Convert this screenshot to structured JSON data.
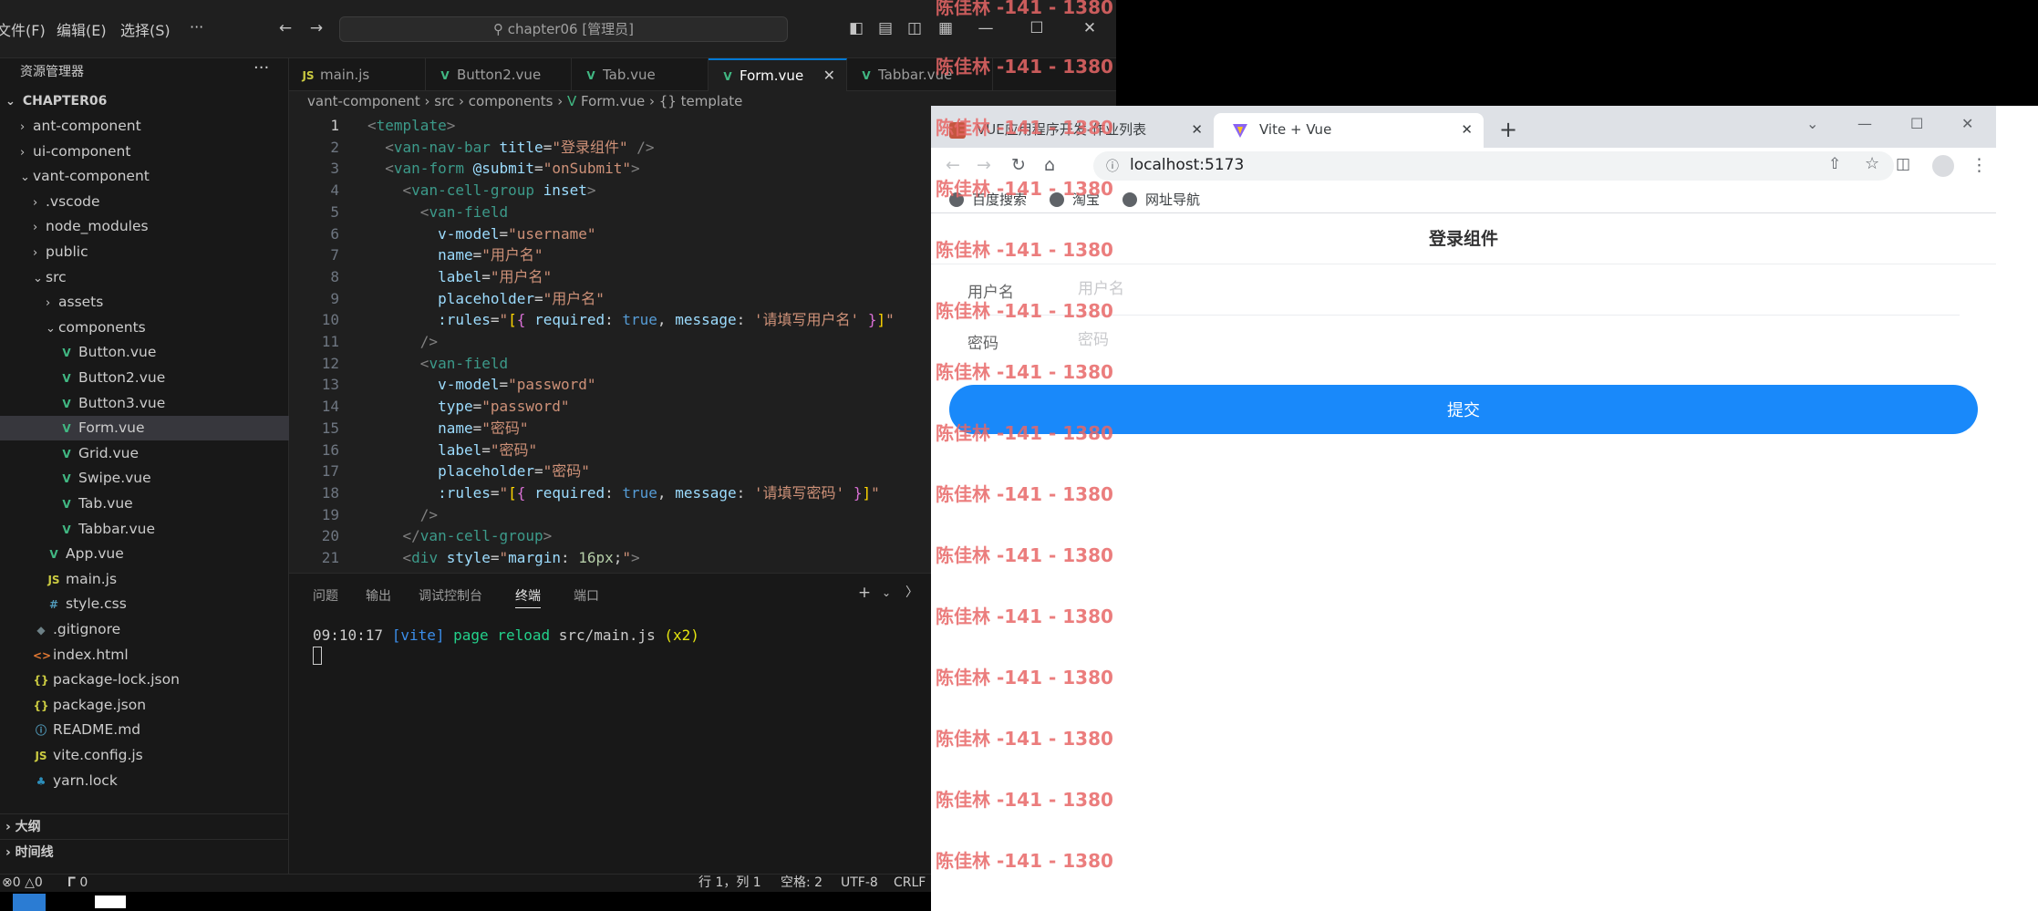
{
  "vscode": {
    "menu": [
      "文件(F)",
      "编辑(E)",
      "选择(S)",
      "···"
    ],
    "command_center": "chapter06 [管理员]",
    "explorer": {
      "title": "资源管理器",
      "more": "···",
      "root": "CHAPTER06",
      "items": [
        {
          "label": "ant-component",
          "icon": "chevron-right-icon"
        },
        {
          "label": "ui-component",
          "icon": "chevron-right-icon"
        },
        {
          "label": "vant-component",
          "icon": "chevron-down-icon"
        },
        {
          "label": ".vscode",
          "icon": "chevron-right-icon"
        },
        {
          "label": "node_modules",
          "icon": "chevron-right-icon"
        },
        {
          "label": "public",
          "icon": "chevron-right-icon"
        },
        {
          "label": "src",
          "icon": "chevron-down-icon"
        },
        {
          "label": "assets",
          "icon": "chevron-right-icon"
        },
        {
          "label": "components",
          "icon": "chevron-down-icon"
        },
        {
          "label": "Button.vue",
          "icon": "vue-icon"
        },
        {
          "label": "Button2.vue",
          "icon": "vue-icon"
        },
        {
          "label": "Button3.vue",
          "icon": "vue-icon"
        },
        {
          "label": "Form.vue",
          "icon": "vue-icon"
        },
        {
          "label": "Grid.vue",
          "icon": "vue-icon"
        },
        {
          "label": "Swipe.vue",
          "icon": "vue-icon"
        },
        {
          "label": "Tab.vue",
          "icon": "vue-icon"
        },
        {
          "label": "Tabbar.vue",
          "icon": "vue-icon"
        },
        {
          "label": "App.vue",
          "icon": "vue-icon"
        },
        {
          "label": "main.js",
          "icon": "js-icon"
        },
        {
          "label": "style.css",
          "icon": "css-icon"
        },
        {
          "label": ".gitignore",
          "icon": "git-icon"
        },
        {
          "label": "index.html",
          "icon": "html-icon"
        },
        {
          "label": "package-lock.json",
          "icon": "json-icon"
        },
        {
          "label": "package.json",
          "icon": "json-icon"
        },
        {
          "label": "README.md",
          "icon": "info-icon"
        },
        {
          "label": "vite.config.js",
          "icon": "js-icon"
        },
        {
          "label": "yarn.lock",
          "icon": "yarn-icon"
        }
      ],
      "sections": [
        "大纲",
        "时间线"
      ]
    },
    "tabs": [
      {
        "label": "main.js",
        "icon": "JS"
      },
      {
        "label": "Button2.vue",
        "icon": "V"
      },
      {
        "label": "Tab.vue",
        "icon": "V"
      },
      {
        "label": "Form.vue",
        "icon": "V"
      },
      {
        "label": "Tabbar.vue",
        "icon": "V"
      }
    ],
    "breadcrumb": [
      "vant-component",
      "src",
      "components",
      "Form.vue",
      "{} template"
    ],
    "code_line_numbers": [
      "1",
      "2",
      "3",
      "4",
      "5",
      "6",
      "7",
      "8",
      "9",
      "10",
      "11",
      "12",
      "13",
      "14",
      "15",
      "16",
      "17",
      "18",
      "19",
      "20",
      "21"
    ],
    "panel_tabs": [
      "问题",
      "输出",
      "调试控制台",
      "终端",
      "端口"
    ],
    "terminal": {
      "time": "09:10:17",
      "tag": "[vite]",
      "message": "page reload",
      "path": "src/main.js",
      "count": "(x2)"
    },
    "status": {
      "errors": "0",
      "warnings": "0",
      "ports": "0",
      "position": "行 1，列 1",
      "spaces": "空格: 2",
      "encoding": "UTF-8",
      "eol": "CRLF"
    }
  },
  "browser": {
    "tabs": [
      {
        "label": "VUE应用程序开发-作业列表"
      },
      {
        "label": "Vite + Vue"
      }
    ],
    "url": "localhost:5173",
    "bookmarks": [
      "百度搜索",
      "淘宝",
      "网址导航"
    ],
    "page": {
      "title": "登录组件",
      "fields": [
        {
          "label": "用户名",
          "placeholder": "用户名"
        },
        {
          "label": "密码",
          "placeholder": "密码"
        }
      ],
      "submit": "提交"
    }
  },
  "watermark": "陈佳林 -141 - 1380"
}
